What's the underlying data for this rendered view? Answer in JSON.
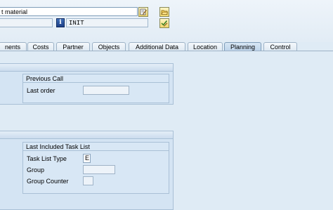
{
  "header": {
    "material_text": "t material",
    "init_value": "INIT"
  },
  "icons": {
    "edit_long_text": "edit-long-text-icon",
    "info": "info-icon",
    "folder_open": "open-folder-icon",
    "check_edit": "check-edit-icon"
  },
  "tabs": [
    {
      "label": "nents",
      "active": false
    },
    {
      "label": "Costs",
      "active": false
    },
    {
      "label": "Partner",
      "active": false
    },
    {
      "label": "Objects",
      "active": false
    },
    {
      "label": "Additional Data",
      "active": false
    },
    {
      "label": "Location",
      "active": false
    },
    {
      "label": "Planning",
      "active": true
    },
    {
      "label": "Control",
      "active": false
    }
  ],
  "previous_call": {
    "title": "Previous Call",
    "last_order_label": "Last order",
    "last_order_value": ""
  },
  "last_task_list": {
    "title": "Last Included Task List",
    "task_list_type_label": "Task List Type",
    "task_list_type_value": "E",
    "group_label": "Group",
    "group_value": "",
    "group_counter_label": "Group Counter",
    "group_counter_value": ""
  }
}
